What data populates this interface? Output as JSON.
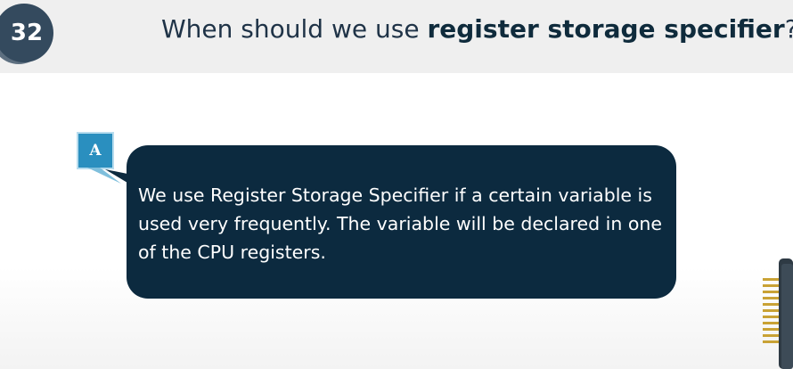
{
  "question": {
    "number": "32",
    "title_prefix": "When should we use ",
    "title_bold": "register storage specifier",
    "title_suffix": "?"
  },
  "answer": {
    "badge": "A",
    "text": "We use Register Storage Specifier if a certain variable is used very frequently. The variable will be declared in one of the CPU registers."
  },
  "colors": {
    "header_bg": "#efefef",
    "badge_bg": "#344a5e",
    "answer_badge_bg": "#2a8fbf",
    "bubble_bg": "#0c2a3f"
  },
  "icons": {
    "decoration": "cpu-chip-icon"
  }
}
